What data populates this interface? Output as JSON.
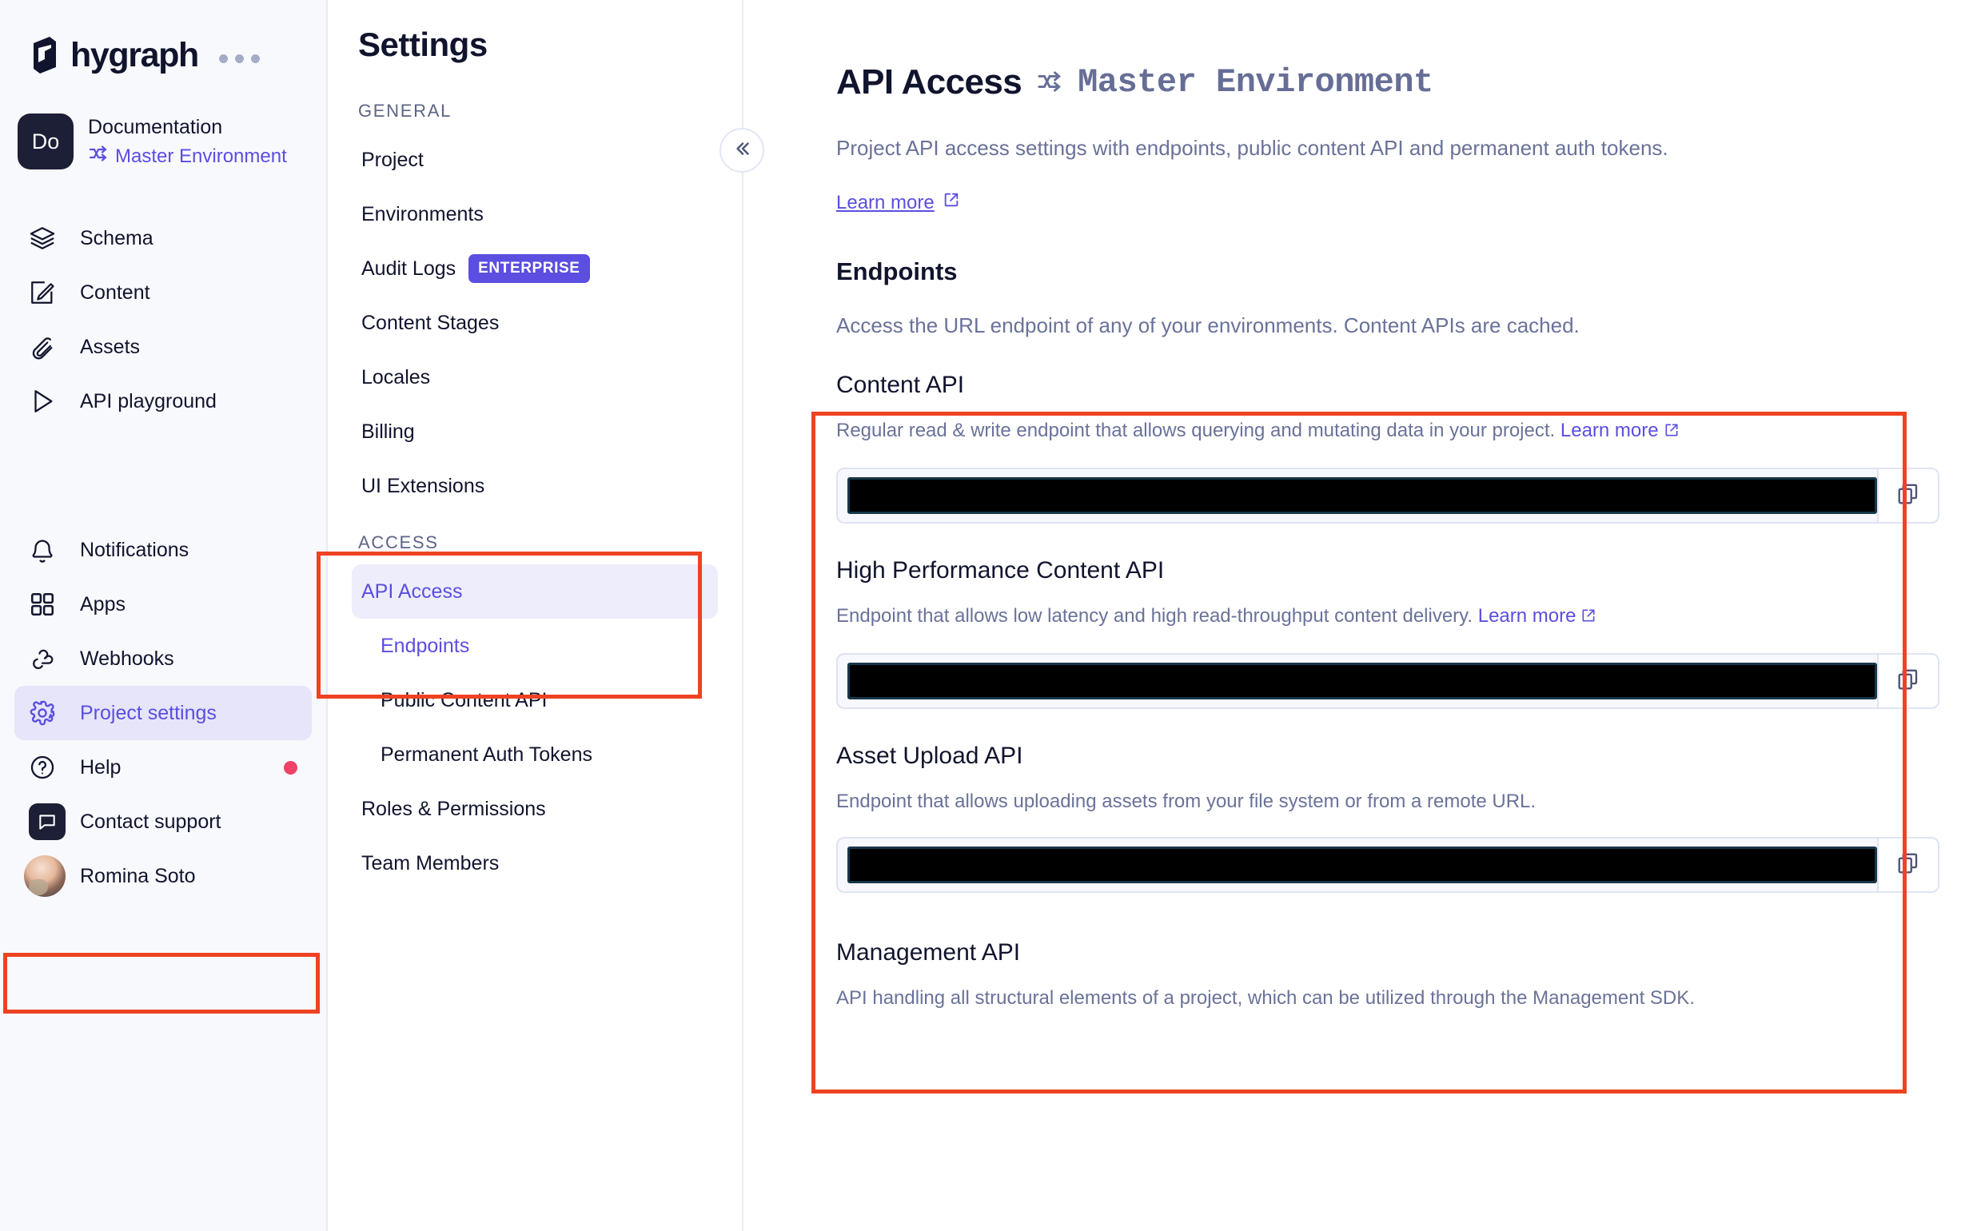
{
  "brand": {
    "name": "hygraph",
    "more_icon": "ellipsis-icon"
  },
  "project": {
    "initials": "Do",
    "name": "Documentation",
    "environment": "Master Environment"
  },
  "leftnav": {
    "items": [
      {
        "label": "Schema",
        "icon": "layers-icon"
      },
      {
        "label": "Content",
        "icon": "edit-square-icon"
      },
      {
        "label": "Assets",
        "icon": "paperclip-icon"
      },
      {
        "label": "API playground",
        "icon": "play-icon"
      }
    ],
    "lower_items": [
      {
        "label": "Notifications",
        "icon": "bell-icon"
      },
      {
        "label": "Apps",
        "icon": "grid-icon"
      },
      {
        "label": "Webhooks",
        "icon": "webhook-icon"
      },
      {
        "label": "Project settings",
        "icon": "gear-icon"
      },
      {
        "label": "Help",
        "icon": "question-circle-icon"
      },
      {
        "label": "Contact support",
        "icon": "chat-icon"
      }
    ],
    "user": "Romina Soto"
  },
  "settings": {
    "title": "Settings",
    "general_label": "GENERAL",
    "general_items": [
      {
        "label": "Project"
      },
      {
        "label": "Environments"
      },
      {
        "label": "Audit Logs",
        "badge": "ENTERPRISE"
      },
      {
        "label": "Content Stages"
      },
      {
        "label": "Locales"
      },
      {
        "label": "Billing"
      },
      {
        "label": "UI Extensions"
      }
    ],
    "access_label": "ACCESS",
    "access_items": [
      {
        "label": "API Access"
      },
      {
        "label": "Endpoints"
      },
      {
        "label": "Public Content API"
      },
      {
        "label": "Permanent Auth Tokens"
      }
    ],
    "footer_items": [
      {
        "label": "Roles & Permissions"
      },
      {
        "label": "Team Members"
      }
    ],
    "collapse_icon": "chevrons-left-icon"
  },
  "main": {
    "title": "API Access",
    "environment": "Master Environment",
    "description": "Project API access settings with endpoints, public content API and permanent auth tokens.",
    "learn_more": "Learn more",
    "endpoints_heading": "Endpoints",
    "endpoints_description": "Access the URL endpoint of any of your environments. Content APIs are cached.",
    "cards": [
      {
        "title": "Content API",
        "description": "Regular read & write endpoint that allows querying and mutating data in your project.",
        "link": "Learn more",
        "value": "",
        "copy_icon": "copy-icon"
      },
      {
        "title": "High Performance Content API",
        "description": "Endpoint that allows low latency and high read-throughput content delivery.",
        "link": "Learn more",
        "value": "",
        "copy_icon": "copy-icon"
      },
      {
        "title": "Asset Upload API",
        "description": "Endpoint that allows uploading assets from your file system or from a remote URL.",
        "link": "",
        "value": "",
        "copy_icon": "copy-icon"
      }
    ],
    "management": {
      "title": "Management API",
      "description": "API handling all structural elements of a project, which can be utilized through the Management SDK."
    }
  },
  "colors": {
    "accent": "#5b4ee0",
    "annotation": "#ee4323",
    "muted": "#6a7299",
    "dark": "#11142d",
    "notify_dot": "#ee4266"
  }
}
